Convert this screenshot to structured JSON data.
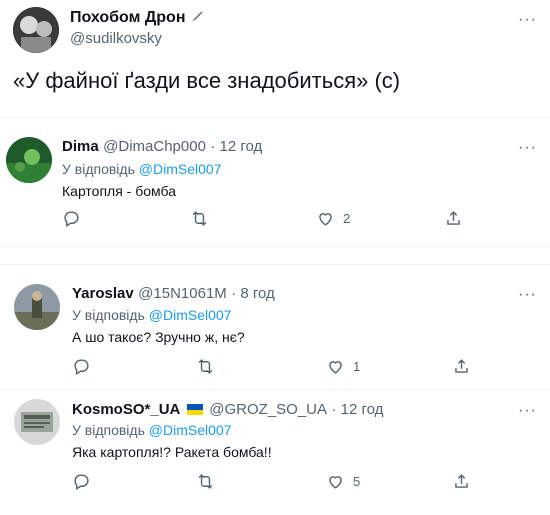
{
  "main_tweet": {
    "name": "Похобом Дрон",
    "handle": "@sudilkovsky",
    "text": "«У файної ґазди все знадобиться» (с)",
    "more": "···"
  },
  "replies": [
    {
      "name": "Dima",
      "handle": "@DimaChp000",
      "time": "· 12 год",
      "reply_prefix": "У відповідь ",
      "reply_mention": "@DimSel007",
      "text": "Картопля - бомба",
      "like_count": "2",
      "more": "···"
    },
    {
      "name": "Yaroslav",
      "handle": "@15N1061M",
      "time": "· 8 год",
      "reply_prefix": "У відповідь ",
      "reply_mention": "@DimSel007",
      "text": "А шо такоє? Зручно ж, нє?",
      "like_count": "1",
      "more": "···"
    },
    {
      "name": "KosmoSO*_UA",
      "handle": "@GROZ_SO_UA",
      "time": "· 12 год",
      "reply_prefix": "У відповідь ",
      "reply_mention": "@DimSel007",
      "text": "Яка картопля!? Ракета бомба!!",
      "like_count": "5",
      "more": "···"
    }
  ],
  "colors": {
    "accent": "#1d9bf0",
    "secondary_text": "#536471",
    "flag_blue": "#0057b7",
    "flag_yellow": "#ffd700"
  },
  "icons": [
    "pencil-icon",
    "more-icon",
    "reply-icon",
    "retweet-icon",
    "like-icon",
    "share-icon",
    "ukraine-flag-icon"
  ]
}
